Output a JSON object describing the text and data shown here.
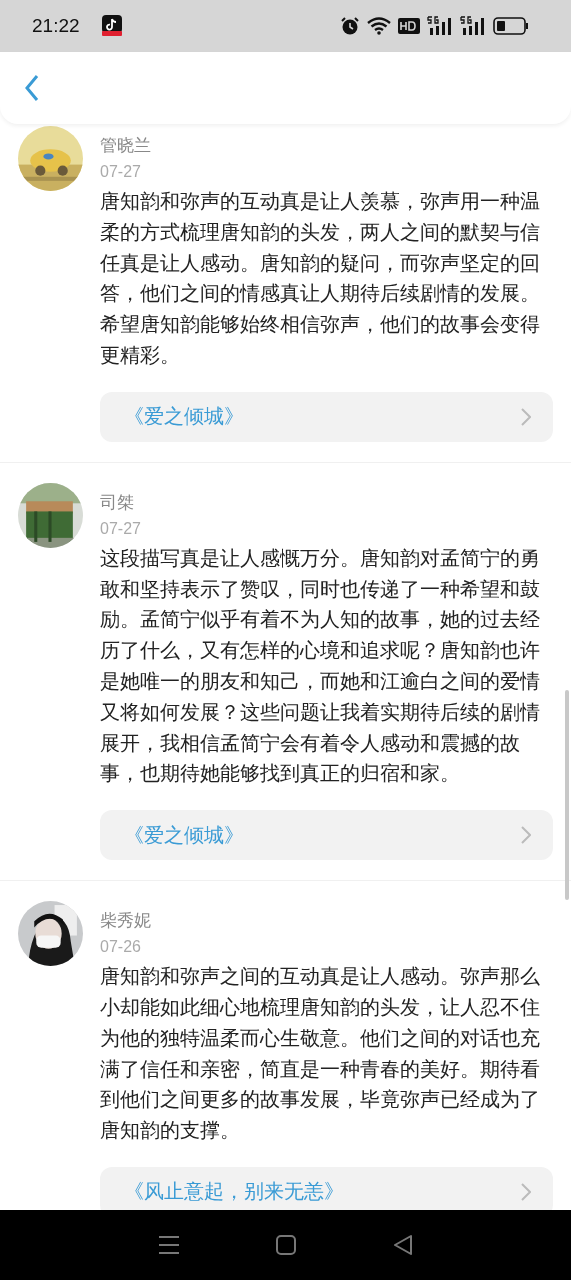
{
  "status_bar": {
    "time": "21:22"
  },
  "comments": [
    {
      "name": "管晓兰",
      "date": "07-27",
      "text": "唐知韵和弥声的互动真是让人羡慕，弥声用一种温柔的方式梳理唐知韵的头发，两人之间的默契与信任真是让人感动。唐知韵的疑问，而弥声坚定的回答，他们之间的情感真让人期待后续剧情的发展。希望唐知韵能够始终相信弥声，他们的故事会变得更精彩。",
      "book": "《爱之倾城》"
    },
    {
      "name": "司桀",
      "date": "07-27",
      "text": "这段描写真是让人感慨万分。唐知韵对孟简宁的勇敢和坚持表示了赞叹，同时也传递了一种希望和鼓励。孟简宁似乎有着不为人知的故事，她的过去经历了什么，又有怎样的心境和追求呢？唐知韵也许是她唯一的朋友和知己，而她和江逾白之间的爱情又将如何发展？这些问题让我着实期待后续的剧情展开，我相信孟简宁会有着令人感动和震撼的故事，也期待她能够找到真正的归宿和家。",
      "book": "《爱之倾城》"
    },
    {
      "name": "柴秀妮",
      "date": "07-26",
      "text": "唐知韵和弥声之间的互动真是让人感动。弥声那么小却能如此细心地梳理唐知韵的头发，让人忍不住为他的独特温柔而心生敬意。他们之间的对话也充满了信任和亲密，简直是一种青春的美好。期待看到他们之间更多的故事发展，毕竟弥声已经成为了唐知韵的支撑。",
      "book": "《风止意起，别来无恙》"
    }
  ]
}
